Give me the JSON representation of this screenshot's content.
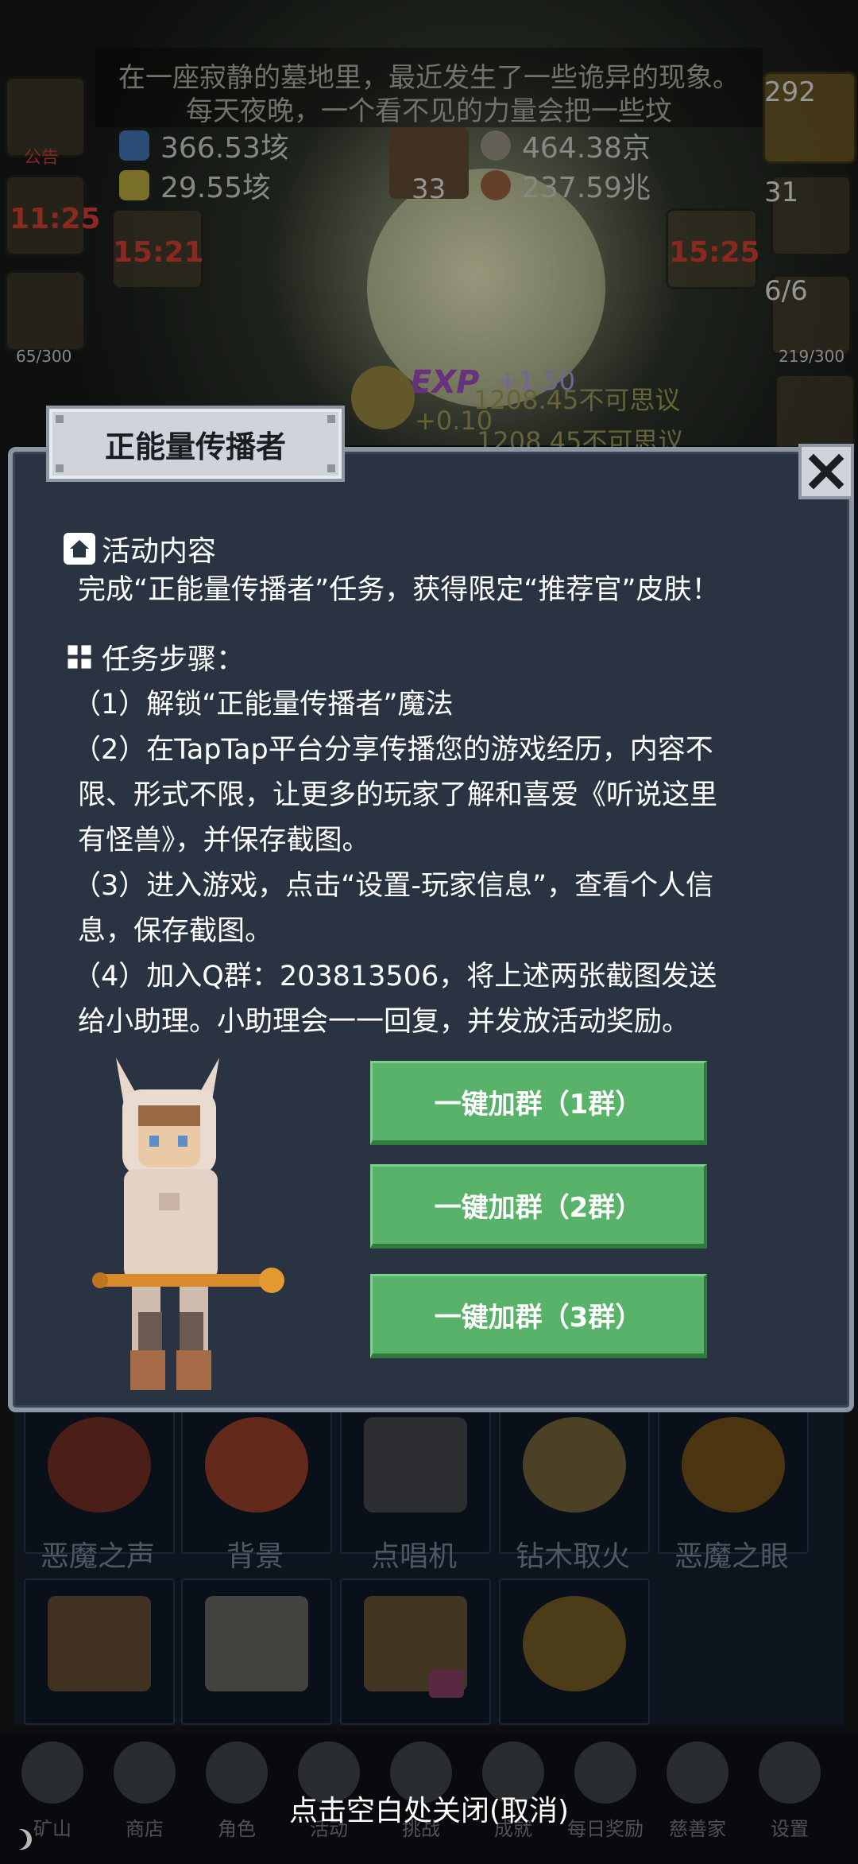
{
  "scene": {
    "story_line1": "在一座寂静的墓地里，最近发生了一些诡异的现象。",
    "story_line2": "每天夜晚，一个看不见的力量会把一些坟",
    "resources": [
      {
        "icon": "blue-potion-icon",
        "value": "366.53垓"
      },
      {
        "icon": "yellow-potion-icon",
        "value": "29.55垓"
      },
      {
        "icon": "stone-icon",
        "value": "464.38京"
      },
      {
        "icon": "meat-icon",
        "value": "237.59兆"
      }
    ],
    "book_count": "33",
    "left_slots": {
      "announcement_label": "公告",
      "timer1": "11:25",
      "bag_count": "65/300"
    },
    "mid_timer": "15:21",
    "right_timer": "15:25",
    "right_slots": {
      "potion_count": "292",
      "chest_count": "31",
      "ratio": "6/6",
      "bag_count": "219/300"
    },
    "exp_label": "EXP",
    "exp_gain": "+1.50",
    "exp_gain2": "+0.10",
    "float_text1": "1208.45不可思议",
    "float_text2": "1208.45不可思议"
  },
  "grid": {
    "row1": [
      "恶魔之声",
      "背景",
      "点唱机",
      "钻木取火",
      "恶魔之眼"
    ]
  },
  "nav": [
    "矿山",
    "商店",
    "角色",
    "活动",
    "挑战",
    "成就",
    "每日奖励",
    "慈善家",
    "设置"
  ],
  "dialog": {
    "title": "正能量传播者",
    "content_heading": "活动内容",
    "content_text": "完成“正能量传播者”任务，获得限定“推荐官”皮肤！",
    "steps_heading": "任务步骤：",
    "steps_lines": [
      "（1）解锁“正能量传播者”魔法",
      "（2）在TapTap平台分享传播您的游戏经历，内容不",
      "限、形式不限，让更多的玩家了解和喜爱《听说这里",
      "有怪兽》，并保存截图。",
      "（3）进入游戏，点击“设置-玩家信息”，查看个人信",
      "息，保存截图。",
      "（4）加入Q群：203813506，将上述两张截图发送",
      "给小助理。小助理会一一回复，并发放活动奖励。"
    ],
    "buttons": [
      "一键加群（1群）",
      "一键加群（2群）",
      "一键加群（3群）"
    ]
  },
  "hint": "点击空白处关闭(取消)"
}
